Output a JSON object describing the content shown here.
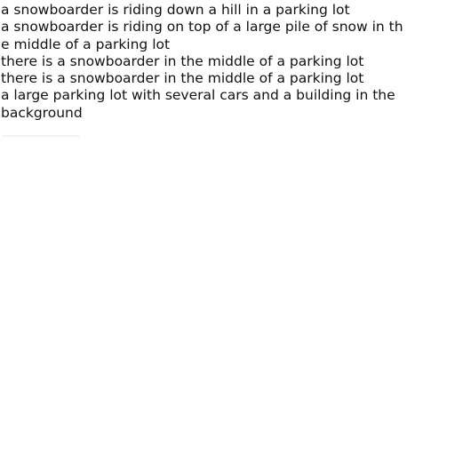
{
  "caption_lines": [
    "a snowboarder is riding down a hill in a parking lot",
    "a snowboarder is riding on top of a large pile of snow in th",
    "e middle of a parking lot",
    "there is a snowboarder in the middle of a parking lot",
    "there is a snowboarder in the middle of a parking lot",
    "a large parking lot with several cars and a building in the",
    "background"
  ],
  "colors": {
    "background": "#ffffff",
    "text": "#111111"
  }
}
